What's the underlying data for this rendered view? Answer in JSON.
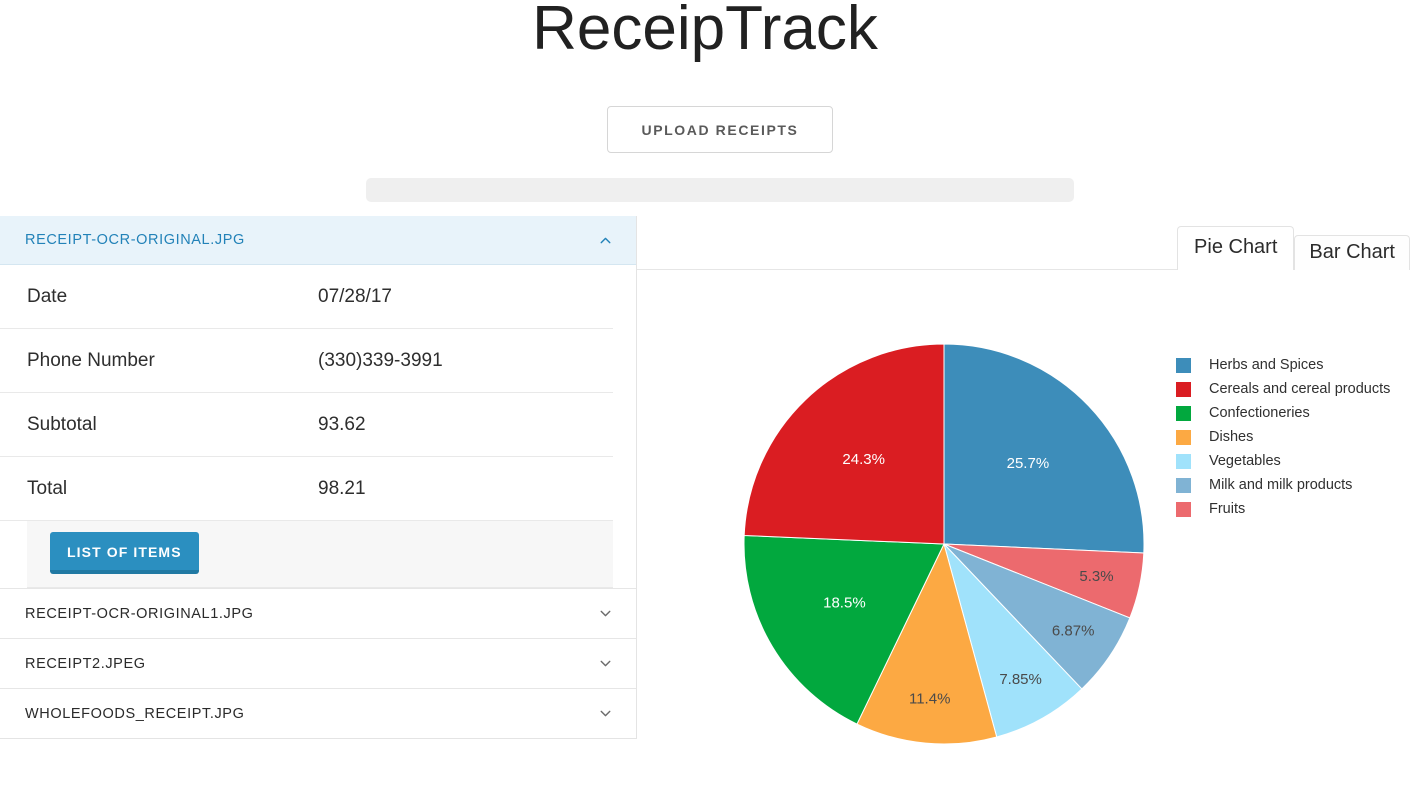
{
  "app": {
    "title": "ReceipTrack"
  },
  "upload": {
    "button_label": "Upload Receipts",
    "progress_percent": 0
  },
  "receipts": [
    {
      "filename": "RECEIPT-OCR-ORIGINAL.JPG",
      "expanded": true,
      "chevron_icon": "chevron-up-icon",
      "fields": [
        {
          "key": "Date",
          "value": "07/28/17"
        },
        {
          "key": "Phone Number",
          "value": "(330)339-3991"
        },
        {
          "key": "Subtotal",
          "value": "93.62"
        },
        {
          "key": "Total",
          "value": "98.21"
        }
      ],
      "items_button_label": "List of Items"
    },
    {
      "filename": "RECEIPT-OCR-ORIGINAL1.JPG",
      "expanded": false,
      "chevron_icon": "chevron-down-icon"
    },
    {
      "filename": "RECEIPT2.JPEG",
      "expanded": false,
      "chevron_icon": "chevron-down-icon"
    },
    {
      "filename": "WHOLEFOODS_RECEIPT.JPG",
      "expanded": false,
      "chevron_icon": "chevron-down-icon"
    }
  ],
  "tabs": [
    {
      "label": "Pie Chart",
      "active": true
    },
    {
      "label": "Bar Chart",
      "active": false
    }
  ],
  "chart_data": {
    "type": "pie",
    "title": "",
    "legend_position": "right",
    "start_angle_deg": -90,
    "direction": "clockwise",
    "labels": [
      "Herbs and Spices",
      "Cereals and cereal products",
      "Confectioneries",
      "Dishes",
      "Vegetables",
      "Milk and milk products",
      "Fruits"
    ],
    "values": [
      25.7,
      24.3,
      18.5,
      11.4,
      7.85,
      6.87,
      5.3
    ],
    "value_labels": [
      "25.7%",
      "24.3%",
      "18.5%",
      "11.4%",
      "7.85%",
      "6.87%",
      "5.3%"
    ],
    "colors": [
      "#3d8dba",
      "#da1d22",
      "#02a83e",
      "#fca943",
      "#a0e2fb",
      "#80b3d4",
      "#ec6a6e"
    ],
    "label_text_colors": [
      "#ffffff",
      "#ffffff",
      "#ffffff",
      "#4a4a4a",
      "#4a4a4a",
      "#4a4a4a",
      "#4a4a4a"
    ],
    "slice_order": [
      {
        "name": "Herbs and Spices",
        "value": 25.7,
        "label": "25.7%",
        "color": "#3d8dba"
      },
      {
        "name": "Fruits",
        "value": 5.3,
        "label": "5.3%",
        "color": "#ec6a6e"
      },
      {
        "name": "Milk and milk products",
        "value": 6.87,
        "label": "6.87%",
        "color": "#80b3d4"
      },
      {
        "name": "Vegetables",
        "value": 7.85,
        "label": "7.85%",
        "color": "#a0e2fb"
      },
      {
        "name": "Dishes",
        "value": 11.4,
        "label": "11.4%",
        "color": "#fca943"
      },
      {
        "name": "Confectioneries",
        "value": 18.5,
        "label": "18.5%",
        "color": "#02a83e"
      },
      {
        "name": "Cereals and cereal products",
        "value": 24.3,
        "label": "24.3%",
        "color": "#da1d22"
      }
    ]
  },
  "theme": {
    "accent_blue": "#2b8fc0",
    "header_blue_bg": "#e8f3fa",
    "header_blue_text": "#2282b8",
    "progress_track": "#efefef"
  }
}
